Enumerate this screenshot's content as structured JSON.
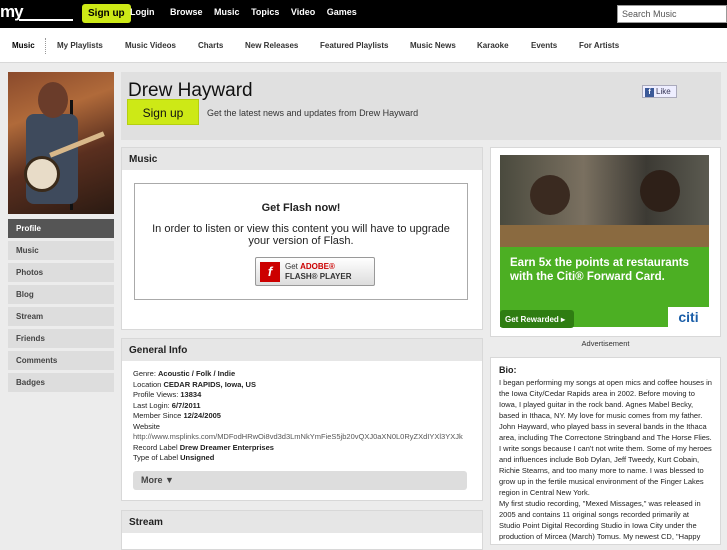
{
  "topbar": {
    "logo": "my",
    "signup": "Sign up",
    "login": "Login",
    "nav": [
      "Browse",
      "Music",
      "Topics",
      "Video",
      "Games"
    ],
    "search_placeholder": "Search Music"
  },
  "subnav": [
    "Music",
    "My Playlists",
    "Music Videos",
    "Charts",
    "New Releases",
    "Featured Playlists",
    "Music News",
    "Karaoke",
    "Events",
    "For Artists"
  ],
  "sidebar": {
    "items": [
      "Profile",
      "Music",
      "Photos",
      "Blog",
      "Stream",
      "Friends",
      "Comments",
      "Badges"
    ]
  },
  "header": {
    "name": "Drew Hayward",
    "signup": "Sign up",
    "tagline": "Get the latest news and updates from Drew Hayward",
    "like": "Like"
  },
  "music": {
    "title": "Music",
    "flash_title": "Get Flash now!",
    "flash_msg": "In order to listen or view this content you will have to upgrade your version of Flash.",
    "badge_line1_pre": "Get ",
    "badge_line1_brand": "ADOBE®",
    "badge_line2": "FLASH® PLAYER"
  },
  "general_info": {
    "title": "General Info",
    "rows": [
      {
        "label": "Genre: ",
        "value": "Acoustic / Folk / Indie"
      },
      {
        "label": "Location ",
        "value": "CEDAR RAPIDS, Iowa, US"
      },
      {
        "label": "Profile Views: ",
        "value": "13834"
      },
      {
        "label": "Last Login: ",
        "value": "6/7/2011"
      },
      {
        "label": "Member Since ",
        "value": "12/24/2005"
      },
      {
        "label": "Website",
        "value": ""
      }
    ],
    "url": "http://www.msplinks.com/MDFodHRwOi8vd3d3LmNkYmFieS5jb20vQXJ0aXN0L0RyZXdIYXl3YXJk",
    "record_label_label": "Record Label ",
    "record_label": "Drew Dreamer Enterprises",
    "label_type_label": "Type of Label ",
    "label_type": "Unsigned",
    "more": "More ▼"
  },
  "stream": {
    "title": "Stream"
  },
  "ad": {
    "headline": "Earn 5x the points at restaurants with the Citi® Forward Card.",
    "button": "Get Rewarded ▸",
    "brand": "citi",
    "label": "Advertisement"
  },
  "bio": {
    "heading": "Bio:",
    "paragraphs": [
      "I began performing my songs at open mics and coffee houses in the Iowa City/Cedar Rapids area in 2002. Before moving to Iowa, I played guitar in the rock band. Agnes Mabel Becky, based in Ithaca, NY. My love for music comes from my father. John Hayward, who played bass in several bands in the Ithaca area, including The Correctone Stringband and The Horse Flies.",
      "I write songs because I can't not write them. Some of my heroes and influences include Bob Dylan, Jeff Tweedy, Kurt Cobain, Richie Stearns, and too many more to name. I was blessed to grow up in the fertile musical environment of the Finger Lakes region in Central New York.",
      "My first studio recording, \"Mexed Missages,\" was released in 2005 and contains 11 original songs recorded primarily at Studio Point Digital Recording Studio in Iowa City under the production of Mircea (March) Tomus. My newest CD, \"Happy"
    ]
  }
}
